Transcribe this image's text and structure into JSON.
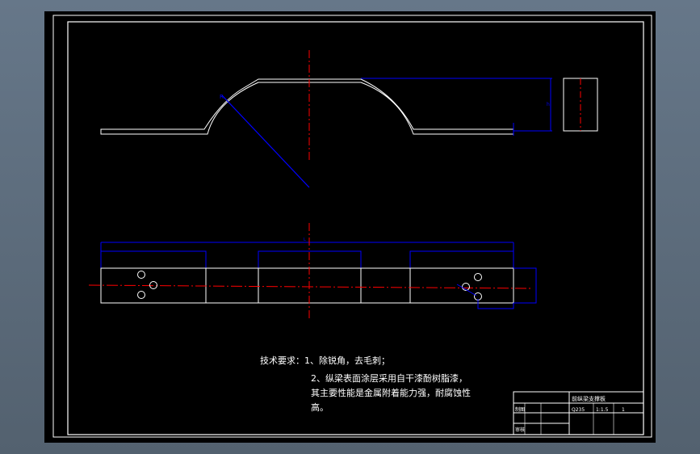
{
  "drawing": {
    "notes": {
      "heading": "技术要求：1、除锐角，去毛刺；",
      "line2": "2、纵梁表面涂层采用自干漆酚树脂漆，",
      "line3": "其主要性能是金属附着能力强，耐腐蚀性",
      "line4": "高。"
    },
    "title_block": {
      "part_name": "前纵梁支撑板",
      "material": "Q235",
      "scale": "1:1.5",
      "qty": "1",
      "cell_a": "制图",
      "cell_b": "审核"
    }
  },
  "colors": {
    "background": "#000000",
    "outline": "#ffffff",
    "dimension": "#0000ff",
    "centerline": "#ff0000"
  }
}
